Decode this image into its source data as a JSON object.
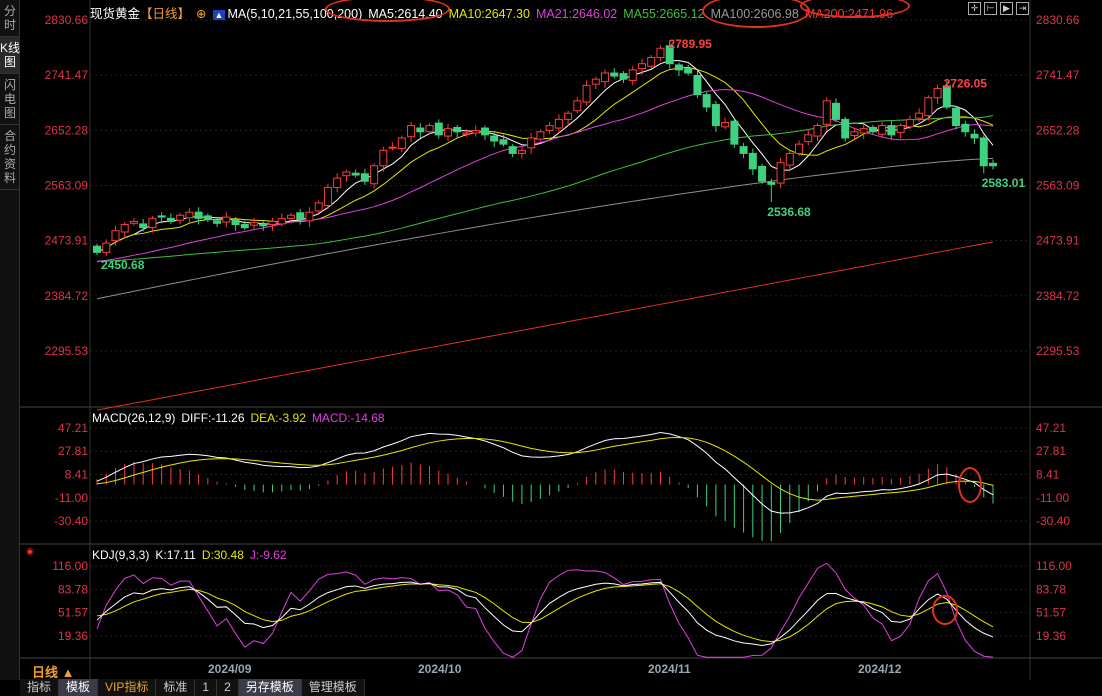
{
  "sidebar": {
    "tabs": [
      "分时",
      "K线图",
      "闪电图",
      "合约资料"
    ],
    "active": 1
  },
  "header": {
    "title": "现货黄金",
    "period": "【日线】",
    "ma_label": "MA(5,10,21,55,100,200)",
    "ma5": "MA5:2614.40",
    "ma10": "MA10:2647.30",
    "ma21": "MA21:2646.02",
    "ma55": "MA55:2665.12",
    "ma100": "MA100:2606.98",
    "ma200": "MA200:2471.96"
  },
  "toolbar_icons": [
    "crosshair-icon",
    "range-icon",
    "play-icon",
    "jump-end-icon"
  ],
  "price_axis": [
    "2830.66",
    "2741.47",
    "2652.28",
    "2563.09",
    "2473.91",
    "2384.72",
    "2295.53"
  ],
  "annotations": {
    "high1": "2789.95",
    "high2": "2726.05",
    "low1": "2450.68",
    "low2": "2536.68",
    "last": "2583.01"
  },
  "macd": {
    "label": "MACD(26,12,9)",
    "diff": "DIFF:-11.26",
    "dea": "DEA:-3.92",
    "macd": "MACD:-14.68",
    "axis": [
      "47.21",
      "27.81",
      "8.41",
      "-11.00",
      "-30.40"
    ]
  },
  "kdj": {
    "label": "KDJ(9,3,3)",
    "k": "K:17.11",
    "d": "D:30.48",
    "j": "J:-9.62",
    "axis": [
      "116.00",
      "83.78",
      "51.57",
      "19.36"
    ]
  },
  "period_selector": "日线 ▲",
  "dates": [
    "2024/09",
    "2024/10",
    "2024/11",
    "2024/12"
  ],
  "bottom_tabs": [
    "指标",
    "模板",
    "VIP指标",
    "标准",
    "1",
    "2",
    "另存模板",
    "管理模板"
  ],
  "colors": {
    "up": "#ff3b3b",
    "down": "#3fd17f",
    "ma5": "#ffffff",
    "ma10": "#e6e600",
    "ma21": "#e040e0",
    "ma55": "#3ec13e",
    "ma100": "#909090",
    "ma200": "#e0321e"
  },
  "chart_data": {
    "type": "candlestick",
    "ylim": [
      2295.53,
      2830.66
    ],
    "closes": [
      2455,
      2470,
      2490,
      2500,
      2505,
      2495,
      2510,
      2512,
      2505,
      2515,
      2520,
      2510,
      2508,
      2502,
      2512,
      2500,
      2495,
      2503,
      2498,
      2505,
      2510,
      2515,
      2508,
      2520,
      2535,
      2560,
      2575,
      2585,
      2580,
      2570,
      2595,
      2620,
      2625,
      2640,
      2660,
      2650,
      2660,
      2645,
      2655,
      2650,
      2648,
      2652,
      2645,
      2635,
      2630,
      2615,
      2620,
      2640,
      2650,
      2660,
      2670,
      2680,
      2700,
      2725,
      2735,
      2745,
      2740,
      2735,
      2750,
      2760,
      2770,
      2785,
      2760,
      2750,
      2745,
      2710,
      2690,
      2660,
      2665,
      2630,
      2615,
      2590,
      2570,
      2565,
      2600,
      2615,
      2630,
      2645,
      2660,
      2700,
      2670,
      2640,
      2650,
      2655,
      2650,
      2660,
      2645,
      2660,
      2670,
      2680,
      2705,
      2720,
      2690,
      2660,
      2650,
      2640,
      2595,
      2595
    ],
    "ma100_range": [
      2380,
      2607
    ],
    "ma200_range": [
      2200,
      2472
    ]
  }
}
